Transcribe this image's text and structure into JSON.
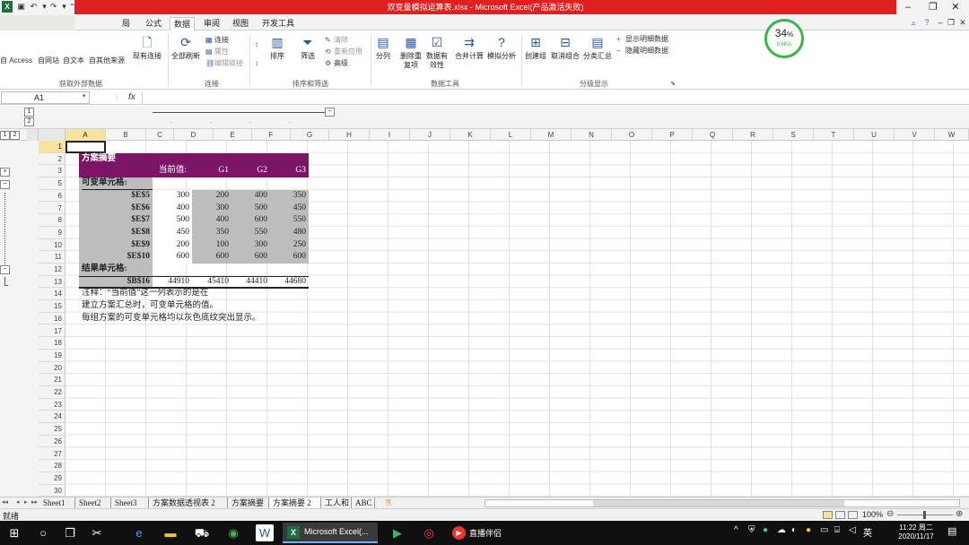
{
  "window": {
    "title": "双变量模拟运算表.xlsx - Microsoft Excel(产品激活失败)",
    "file_icon": "excel-icon"
  },
  "ribbon_tabs": [
    "局",
    "公式",
    "数据",
    "审阅",
    "视图",
    "开发工具"
  ],
  "ribbon": {
    "get_external": [
      "自 Access",
      "自网站",
      "自文本",
      "自其他来源",
      "现有连接"
    ],
    "get_external_group": "获取外部数据",
    "refresh_all": "全部刷新",
    "conn_items": [
      "连接",
      "属性",
      "编辑链接"
    ],
    "conn_group": "连接",
    "sort": "排序",
    "filter": "筛选",
    "filter_items": [
      "清除",
      "重新应用",
      "高级"
    ],
    "sort_group": "排序和筛选",
    "tools": [
      "分列",
      "删除重复项",
      "数据有效性",
      "合并计算",
      "模拟分析"
    ],
    "tools_group": "数据工具",
    "outline": [
      "创建组",
      "取消组合",
      "分类汇总"
    ],
    "outline_items": [
      "显示明细数据",
      "隐藏明细数据"
    ],
    "outline_group": "分级显示"
  },
  "progress": {
    "value": "34",
    "unit": "%",
    "speed": "9.6K/s"
  },
  "formula_bar": {
    "name_box": "A1",
    "fx": "fx",
    "content": ""
  },
  "outline_levels": [
    "1",
    "2"
  ],
  "columns": [
    "A",
    "B",
    "C",
    "D",
    "E",
    "F",
    "G",
    "H",
    "I",
    "J",
    "K",
    "L",
    "M",
    "N",
    "O",
    "P",
    "Q",
    "R",
    "S",
    "T",
    "U",
    "V",
    "W"
  ],
  "rows": [
    "1",
    "2",
    "3",
    "5",
    "6",
    "7",
    "8",
    "9",
    "10",
    "11",
    "12",
    "13",
    "14",
    "15",
    "16",
    "17",
    "18",
    "19",
    "20",
    "21",
    "22",
    "23",
    "24",
    "25",
    "26",
    "27",
    "28",
    "29",
    "30"
  ],
  "scenario": {
    "title": "方案摘要",
    "header_labels": [
      "当前值:",
      "G1",
      "G2",
      "G3"
    ],
    "changing_label": "可变单元格:",
    "changing_rows": [
      {
        "cell": "$E$5",
        "values": [
          "300",
          "200",
          "400",
          "350"
        ]
      },
      {
        "cell": "$E$6",
        "values": [
          "400",
          "300",
          "500",
          "450"
        ]
      },
      {
        "cell": "$E$7",
        "values": [
          "500",
          "400",
          "600",
          "550"
        ]
      },
      {
        "cell": "$E$8",
        "values": [
          "450",
          "350",
          "550",
          "480"
        ]
      },
      {
        "cell": "$E$9",
        "values": [
          "200",
          "100",
          "300",
          "250"
        ]
      },
      {
        "cell": "$E$10",
        "values": [
          "600",
          "600",
          "600",
          "600"
        ]
      }
    ],
    "result_label": "结果单元格:",
    "result_row": {
      "cell": "$B$16",
      "values": [
        "44910",
        "45410",
        "44410",
        "44680"
      ]
    },
    "notes": [
      "注释：“当前值”这一列表示的是在",
      "建立方案汇总时，可变单元格的值。",
      "每组方案的可变单元格均以灰色底纹突出显示。"
    ]
  },
  "sheet_tabs": [
    "Sheet1",
    "Sheet2",
    "Sheet3",
    "方案数据透视表 2",
    "方案摘要",
    "方案摘要 2",
    "工人和",
    "ABC"
  ],
  "active_sheet_index": 5,
  "status": {
    "mode": "就绪",
    "zoom": "100%"
  },
  "taskbar": {
    "excel_label": "Microsoft Excel(...",
    "live_label": "直播伴侣",
    "time": "11:22 周二",
    "date": "2020/11/17"
  },
  "colors": {
    "header_purple": "#7a1568",
    "changing_gray": "#bdbdbd",
    "title_red": "#e02020",
    "selection": "#f7e3a0"
  }
}
